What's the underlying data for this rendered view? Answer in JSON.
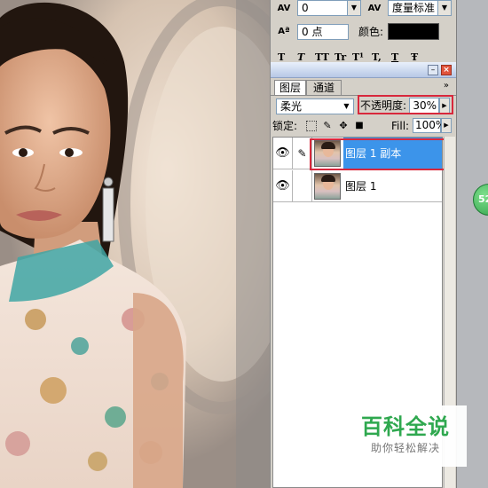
{
  "character_panel": {
    "kerning_value": "0",
    "tracking_value": "度量标准",
    "leading_value": "0 点",
    "color_label": "颜色:",
    "text_color": "#000000",
    "style_buttons": [
      "T",
      "T",
      "TT",
      "Tr",
      "T¹",
      "T,",
      "T",
      "Ŧ"
    ]
  },
  "layers_panel": {
    "tabs": [
      {
        "label": "图层"
      },
      {
        "label": "通道"
      }
    ],
    "blend_mode": "柔光",
    "opacity_label": "不透明度:",
    "opacity_value": "30%",
    "lock_label": "锁定:",
    "fill_label": "Fill:",
    "fill_value": "100%",
    "layers": [
      {
        "name": "图层 1 副本",
        "selected": true
      },
      {
        "name": "图层 1",
        "selected": false
      }
    ]
  },
  "side_badge": {
    "text": "52"
  },
  "watermark": {
    "title": "百科全说",
    "subtitle": "助你轻松解决"
  },
  "colors": {
    "selection_blue": "#3c94ea",
    "highlight_red": "#d8283c",
    "watermark_green": "#2fa84f",
    "panel_gray": "#d4d0c8"
  }
}
